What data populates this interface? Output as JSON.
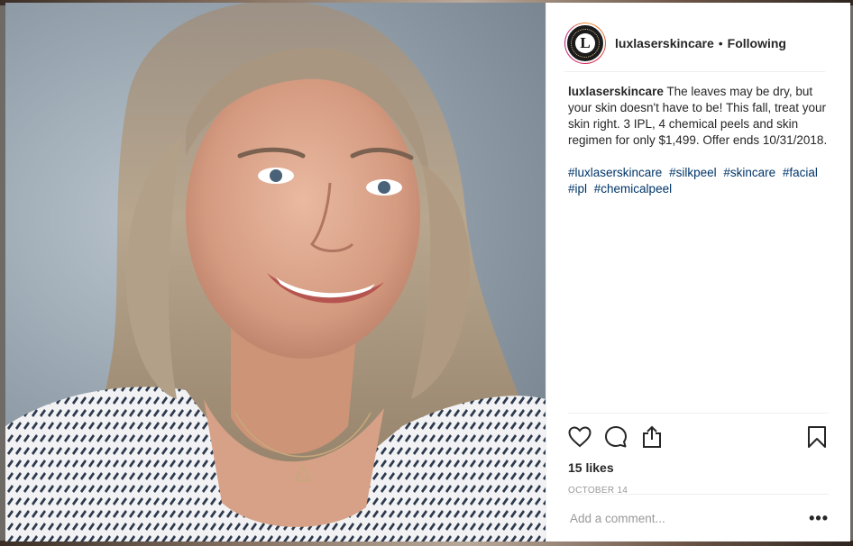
{
  "post": {
    "username": "luxlaserskincare",
    "separator": "•",
    "follow_status": "Following",
    "avatar_letter": "L",
    "caption_user": "luxlaserskincare",
    "caption_text": "The leaves may be dry, but your skin doesn't have to be! This fall, treat your skin right. 3 IPL, 4 chemical peels and skin regimen for only $1,499. Offer ends 10/31/2018.",
    "hashtags": [
      "#luxlaserskincare",
      "#silkpeel",
      "#skincare",
      "#facial",
      "#ipl",
      "#chemicalpeel"
    ],
    "likes": "15 likes",
    "date": "OCTOBER 14",
    "comment_placeholder": "Add a comment...",
    "more_label": "•••"
  },
  "icons": {
    "like": "heart-icon",
    "comment": "comment-bubble-icon",
    "share": "share-icon",
    "save": "bookmark-icon",
    "more": "more-options-icon"
  },
  "colors": {
    "hashtag": "#003569",
    "text": "#262626",
    "muted": "#999999",
    "divider": "#efefef"
  }
}
